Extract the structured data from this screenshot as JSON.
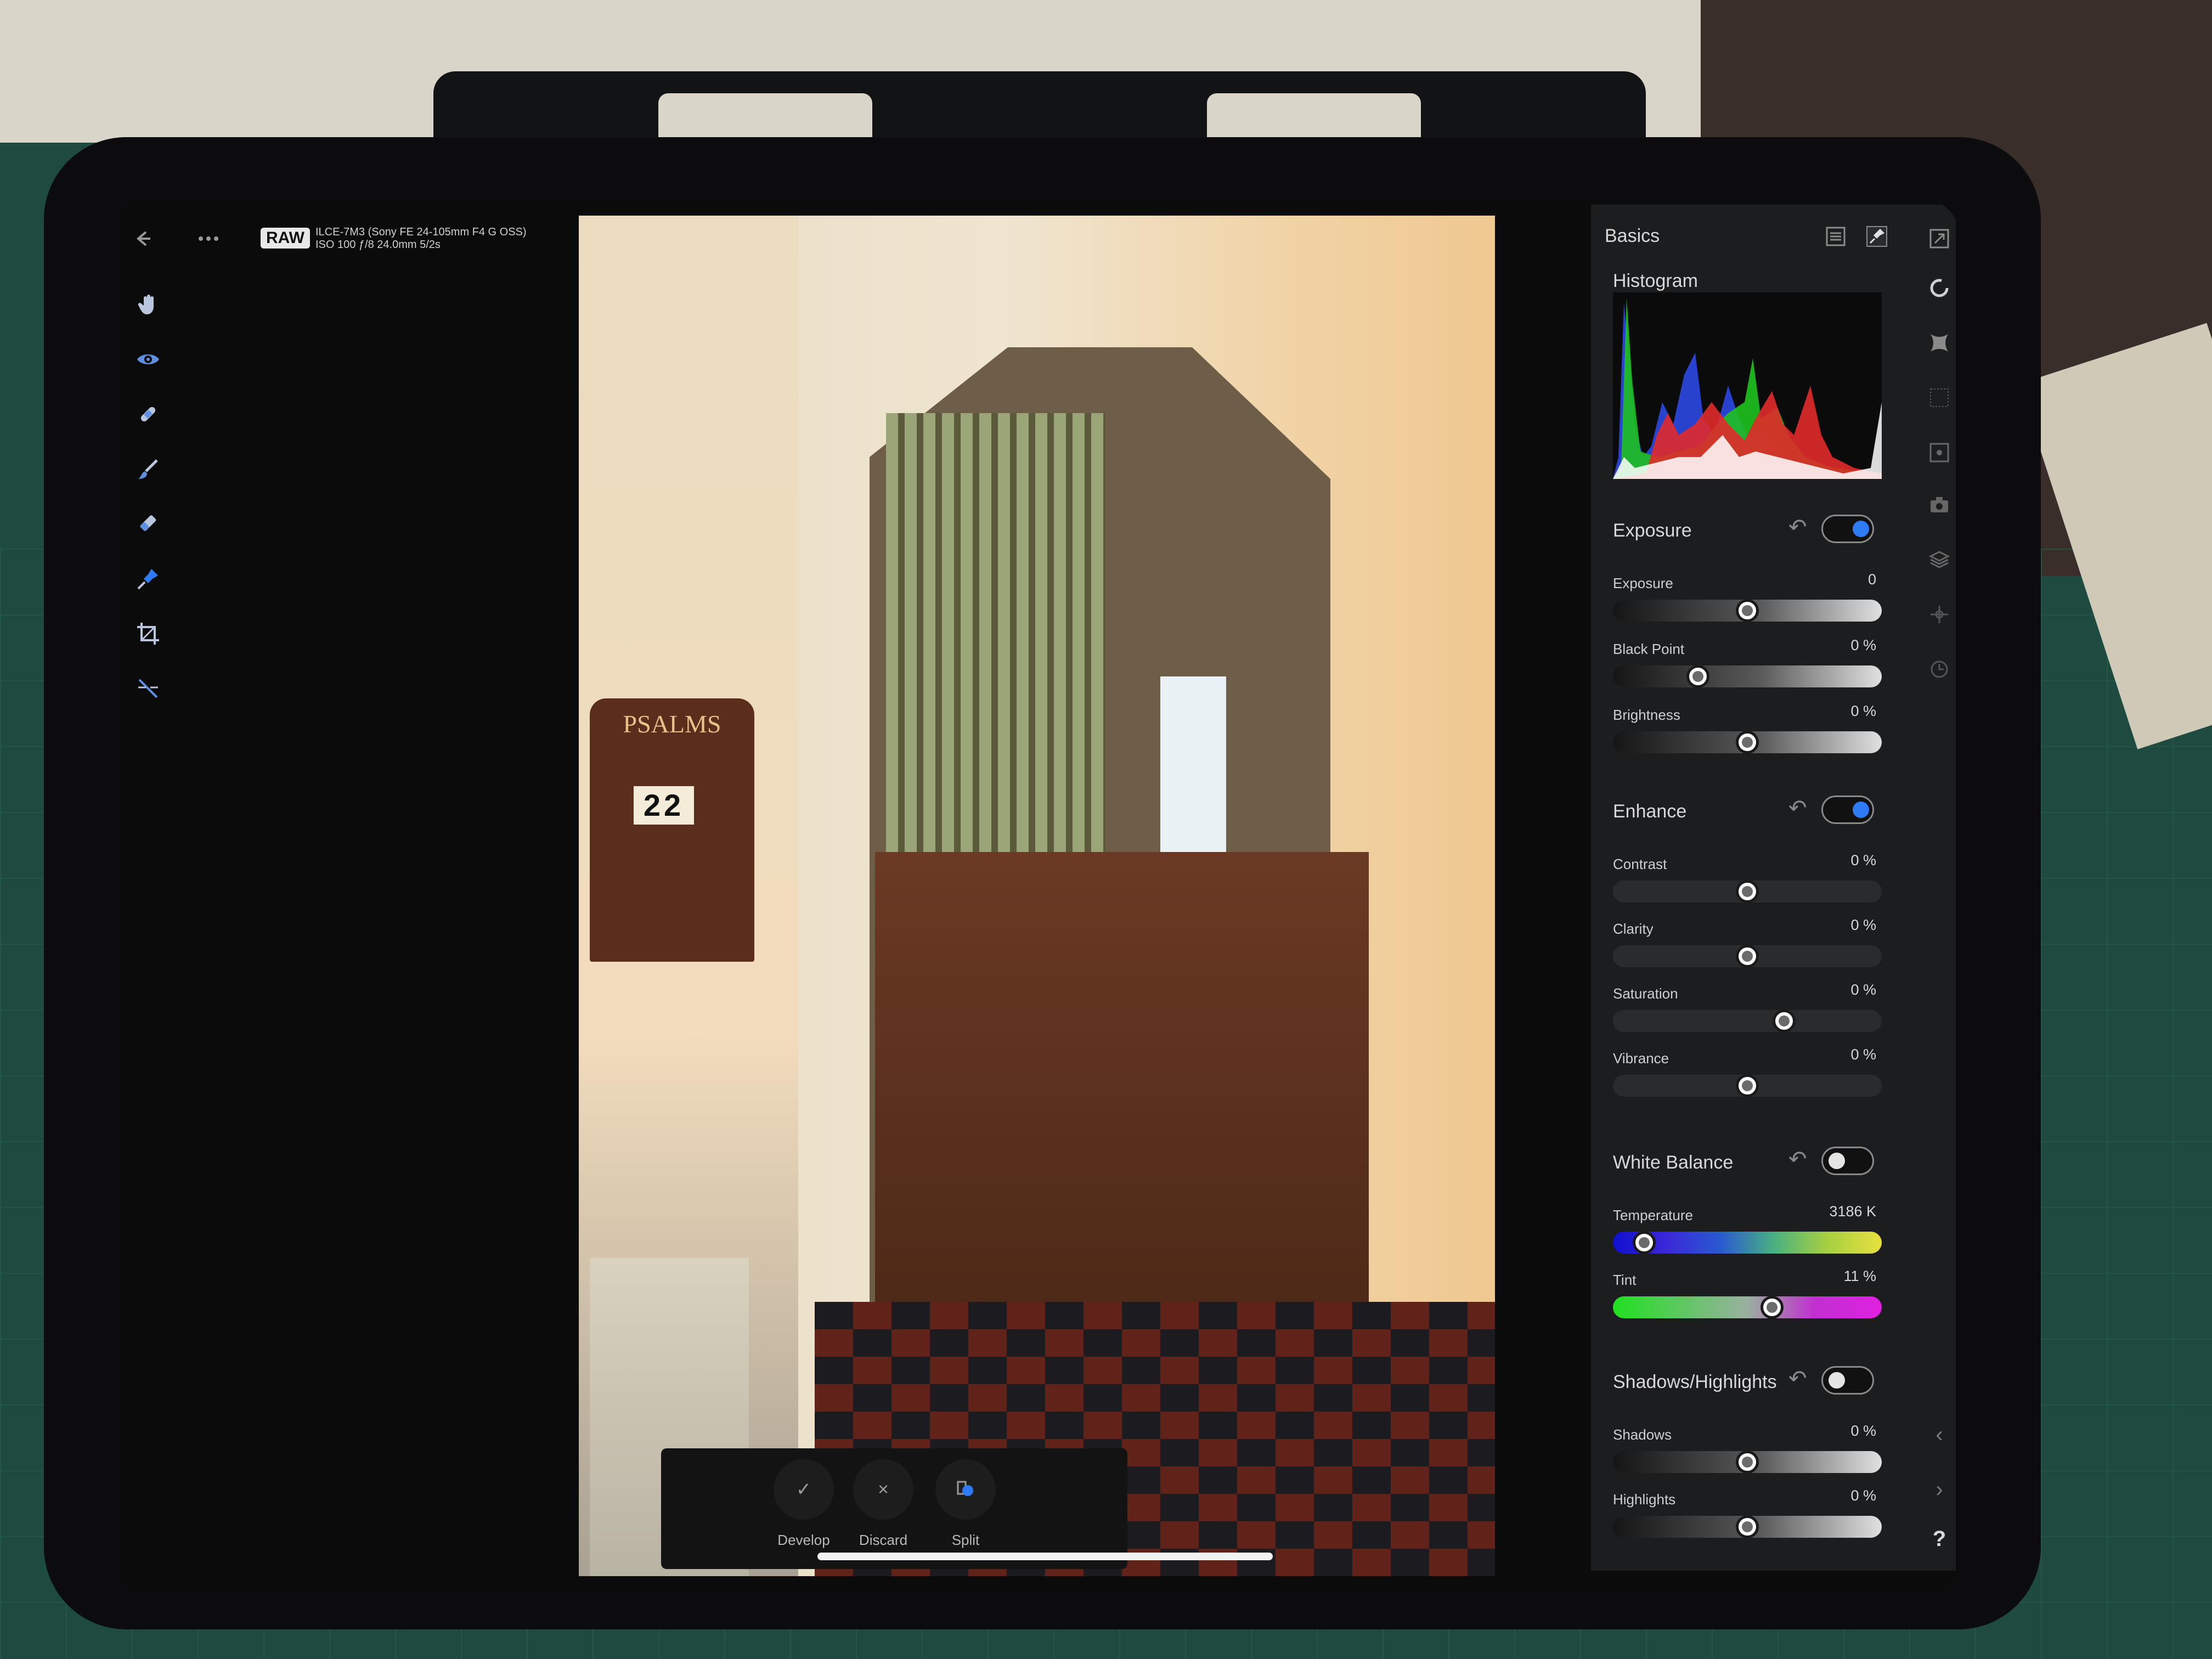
{
  "top_bar": {
    "back_icon": "arrow-left-icon",
    "more_icon": "ellipsis-icon",
    "format_badge": "RAW",
    "camera_line": "ILCE-7M3 (Sony FE 24-105mm F4 G OSS)",
    "exposure_line": "ISO 100 ƒ/8 24.0mm 5/2s"
  },
  "tools": [
    {
      "name": "hand-tool",
      "icon": "hand-icon"
    },
    {
      "name": "view-tool",
      "icon": "eye-icon"
    },
    {
      "name": "blemish-tool",
      "icon": "bandage-icon"
    },
    {
      "name": "brush-tool",
      "icon": "brush-icon"
    },
    {
      "name": "eraser-tool",
      "icon": "eraser-icon"
    },
    {
      "name": "gradient-tool",
      "icon": "pin-icon"
    },
    {
      "name": "crop-tool",
      "icon": "crop-icon"
    },
    {
      "name": "straighten-tool",
      "icon": "straighten-icon"
    }
  ],
  "photo": {
    "board_title": "PSALMS",
    "board_number": "22"
  },
  "actions": {
    "develop": "Develop",
    "discard": "Discard",
    "split": "Split"
  },
  "panel": {
    "title": "Basics",
    "histogram_title": "Histogram",
    "histogram_colors": [
      "#2a46d8",
      "#1fc21f",
      "#e02a2a",
      "#ffffff"
    ],
    "exposure": {
      "title": "Exposure",
      "enabled": true,
      "sliders": [
        {
          "label": "Exposure",
          "value": "0",
          "position": 0.5,
          "track": "gray"
        },
        {
          "label": "Black Point",
          "value": "0 %",
          "position": 0.3,
          "track": "gray"
        },
        {
          "label": "Brightness",
          "value": "0 %",
          "position": 0.5,
          "track": "gray"
        }
      ]
    },
    "enhance": {
      "title": "Enhance",
      "enabled": true,
      "sliders": [
        {
          "label": "Contrast",
          "value": "0 %",
          "position": 0.5,
          "track": "dark"
        },
        {
          "label": "Clarity",
          "value": "0 %",
          "position": 0.5,
          "track": "dark"
        },
        {
          "label": "Saturation",
          "value": "0 %",
          "position": 0.65,
          "track": "dark"
        },
        {
          "label": "Vibrance",
          "value": "0 %",
          "position": 0.5,
          "track": "dark"
        }
      ]
    },
    "white_balance": {
      "title": "White Balance",
      "enabled": false,
      "sliders": [
        {
          "label": "Temperature",
          "value": "3186 K",
          "position": 0.08,
          "track": "temp"
        },
        {
          "label": "Tint",
          "value": "11 %",
          "position": 0.6,
          "track": "tint"
        }
      ]
    },
    "shadows_highlights": {
      "title": "Shadows/Highlights",
      "enabled": false,
      "sliders": [
        {
          "label": "Shadows",
          "value": "0 %",
          "position": 0.5,
          "track": "gray"
        },
        {
          "label": "Highlights",
          "value": "0 %",
          "position": 0.5,
          "track": "gray"
        }
      ]
    }
  },
  "accent": "#2f7bf5",
  "help": "?"
}
